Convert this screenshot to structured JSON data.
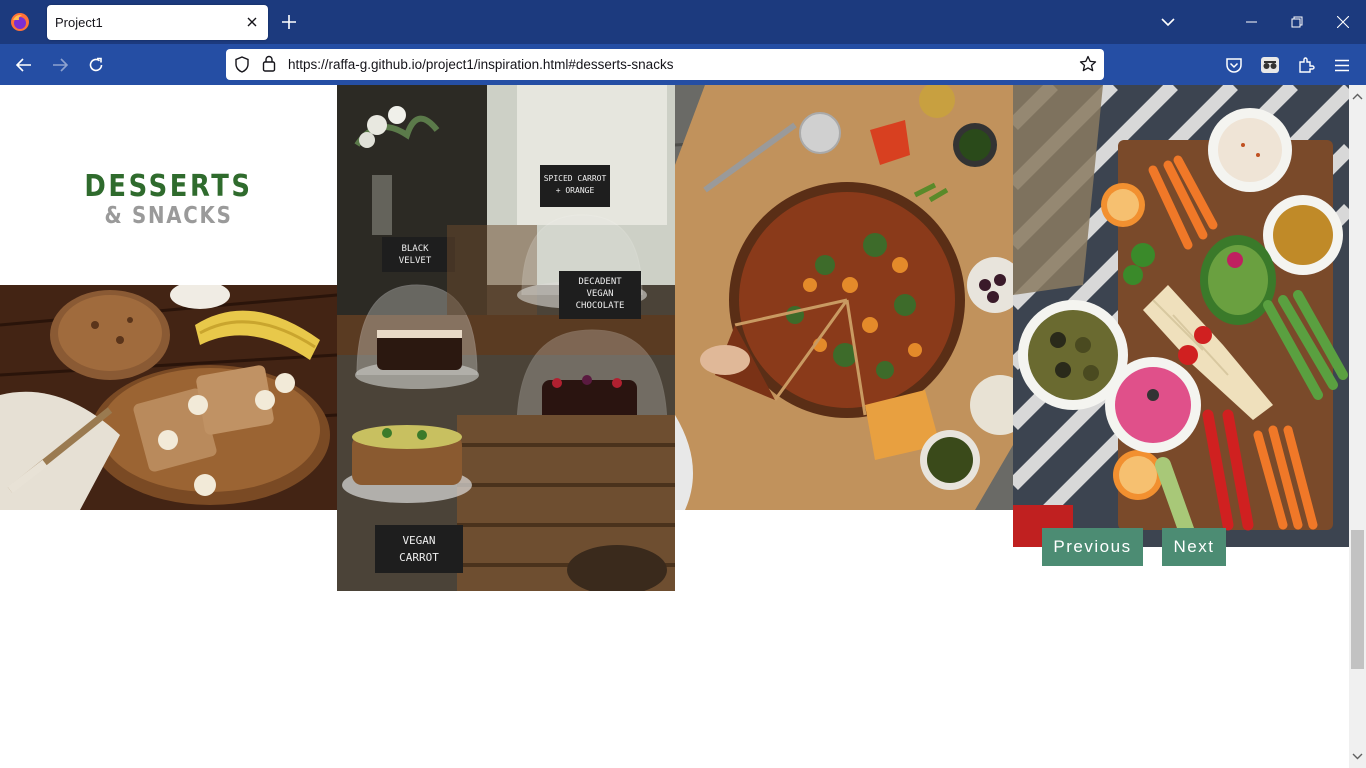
{
  "browser": {
    "tab_title": "Project1",
    "url": "https://raffa-g.github.io/project1/inspiration.html#desserts-snacks"
  },
  "page": {
    "heading_main": "DESSERTS",
    "heading_sub": "& SNACKS",
    "photos": [
      {
        "subject": "banana bread on wooden board"
      },
      {
        "subject": "cake display with chalkboard labels",
        "labels": [
          "SPICED CARROT + ORANGE",
          "BLACK VELVET",
          "DECADENT VEGAN CHOCOLATE",
          "VEGAN CARROT"
        ]
      },
      {
        "subject": "pizza on cutting board"
      },
      {
        "subject": "vegetable snack platter"
      }
    ],
    "pager": {
      "previous_label": "Previous",
      "next_label": "Next"
    }
  },
  "colors": {
    "tabbar": "#1c3a7e",
    "navbar": "#254ea4",
    "heading_main": "#2f6b2d",
    "heading_sub": "#9a9a9a",
    "button": "#4c8c73"
  }
}
